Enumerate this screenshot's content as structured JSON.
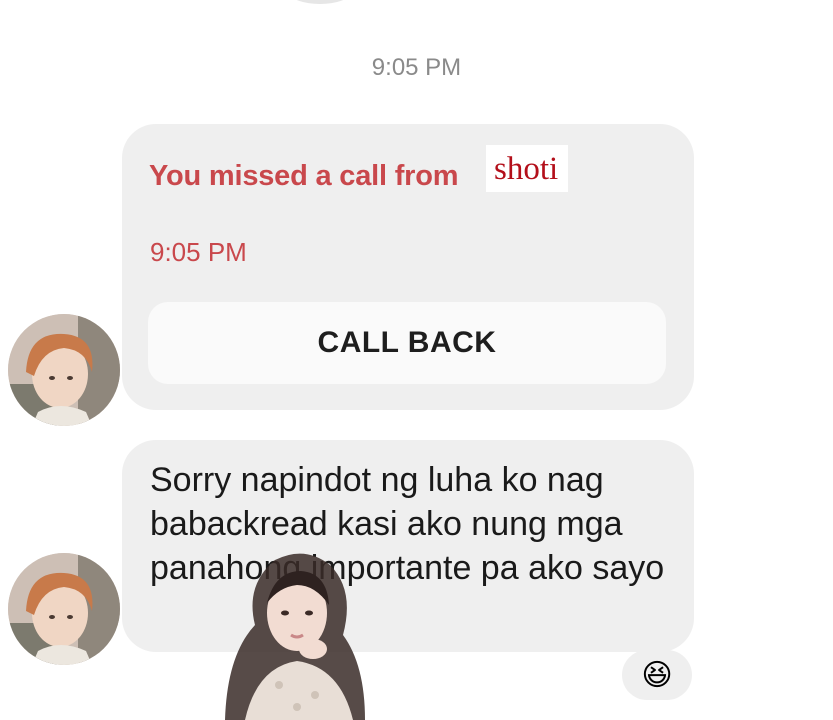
{
  "conversation": {
    "timestamp": "9:05 PM",
    "missed_call": {
      "prefix_text": "You missed a call from",
      "caller_name": "shoti",
      "time": "9:05 PM",
      "callback_label": "CALL BACK"
    },
    "message": {
      "text": "Sorry napindot ng luha ko nag babackread kasi ako nung mga panahong importante pa ako sayo"
    },
    "reaction": {
      "emoji": "😆"
    }
  },
  "icons": {
    "avatar": "profile-photo",
    "sticker": "girl-photo-sticker"
  },
  "colors": {
    "bubble": "#efefef",
    "missed_call_text": "#c9484c",
    "caller_name": "#b30f1a",
    "timestamp": "#8a8a8a"
  }
}
